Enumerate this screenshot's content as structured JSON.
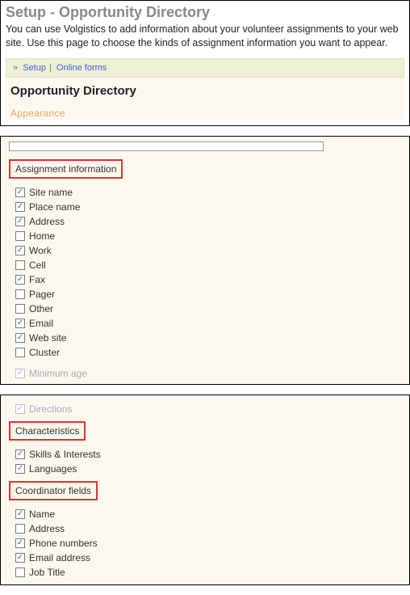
{
  "header": {
    "title": "Setup - Opportunity Directory",
    "description": "You can use Volgistics to add information about your volunteer assignments to your web site. Use this page to choose the kinds of assignment information you want to appear."
  },
  "breadcrumb": {
    "prefix": "»",
    "items": [
      "Setup",
      "Online forms"
    ]
  },
  "subhead": "Opportunity Directory",
  "faded_section": "Appearance",
  "sections": {
    "assignment_info": {
      "label": "Assignment information",
      "items": [
        {
          "label": "Site name",
          "checked": true
        },
        {
          "label": "Place name",
          "checked": true
        },
        {
          "label": "Address",
          "checked": true
        },
        {
          "label": "Home",
          "checked": false
        },
        {
          "label": "Work",
          "checked": true
        },
        {
          "label": "Cell",
          "checked": false
        },
        {
          "label": "Fax",
          "checked": true
        },
        {
          "label": "Pager",
          "checked": false
        },
        {
          "label": "Other",
          "checked": false
        },
        {
          "label": "Email",
          "checked": true
        },
        {
          "label": "Web site",
          "checked": true
        },
        {
          "label": "Cluster",
          "checked": false
        }
      ],
      "trailing_muted": {
        "label": "Minimum age",
        "checked": true
      }
    },
    "directions_lead": {
      "label": "Directions",
      "checked": true,
      "muted": true
    },
    "characteristics": {
      "label": "Characteristics",
      "items": [
        {
          "label": "Skills & Interests",
          "checked": true
        },
        {
          "label": "Languages",
          "checked": true
        }
      ]
    },
    "coordinator": {
      "label": "Coordinator fields",
      "items": [
        {
          "label": "Name",
          "checked": true
        },
        {
          "label": "Address",
          "checked": false
        },
        {
          "label": "Phone numbers",
          "checked": true
        },
        {
          "label": "Email address",
          "checked": true
        },
        {
          "label": "Job Title",
          "checked": false
        }
      ]
    }
  }
}
